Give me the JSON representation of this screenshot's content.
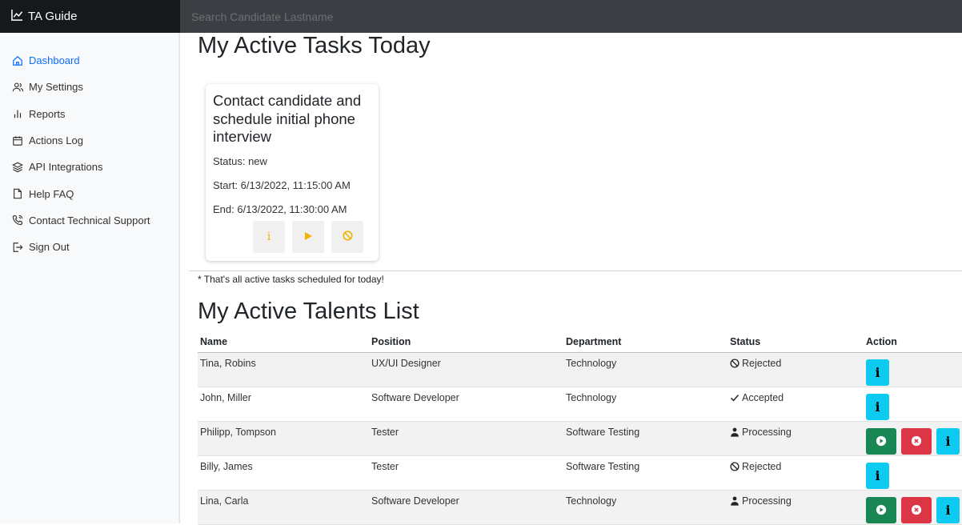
{
  "brand": {
    "name": "TA Guide",
    "icon": "line-chart-icon"
  },
  "search": {
    "placeholder": "Search Candidate Lastname"
  },
  "sidebar": {
    "items": [
      {
        "label": "Dashboard",
        "icon": "home-icon",
        "active": true
      },
      {
        "label": "My Settings",
        "icon": "users-icon"
      },
      {
        "label": "Reports",
        "icon": "bar-chart-icon"
      },
      {
        "label": "Actions Log",
        "icon": "calendar-icon"
      },
      {
        "label": "API Integrations",
        "icon": "layers-icon"
      },
      {
        "label": "Help FAQ",
        "icon": "file-icon"
      },
      {
        "label": "Contact Technical Support",
        "icon": "phone-icon"
      },
      {
        "label": "Sign Out",
        "icon": "sign-out-icon"
      }
    ]
  },
  "tasks": {
    "heading": "My Active Tasks Today",
    "card": {
      "title": "Contact candidate and schedule initial phone interview",
      "status": "Status: new",
      "start": "Start: 6/13/2022, 11:15:00 AM",
      "end": "End: 6/13/2022, 11:30:00 AM",
      "buttons": {
        "info": "i"
      }
    },
    "note": "* That's all active tasks scheduled for today!"
  },
  "talents": {
    "heading": "My Active Talents List",
    "columns": [
      "Name",
      "Position",
      "Department",
      "Status",
      "Action"
    ],
    "rows": [
      {
        "name": "Tina, Robins",
        "position": "UX/UI Designer",
        "department": "Technology",
        "status": "Rejected",
        "status_icon": "ban-icon",
        "actions": [
          "info"
        ]
      },
      {
        "name": "John, Miller",
        "position": "Software Developer",
        "department": "Technology",
        "status": "Accepted",
        "status_icon": "check-icon",
        "actions": [
          "info"
        ]
      },
      {
        "name": "Philipp, Tompson",
        "position": "Tester",
        "department": "Software Testing",
        "status": "Processing",
        "status_icon": "user-icon",
        "actions": [
          "start",
          "cancel",
          "info"
        ]
      },
      {
        "name": "Billy, James",
        "position": "Tester",
        "department": "Software Testing",
        "status": "Rejected",
        "status_icon": "ban-icon",
        "actions": [
          "info"
        ]
      },
      {
        "name": "Lina, Carla",
        "position": "Software Developer",
        "department": "Technology",
        "status": "Processing",
        "status_icon": "user-icon",
        "actions": [
          "start",
          "cancel",
          "info"
        ]
      }
    ],
    "info_label": "i"
  },
  "colors": {
    "accent": "#0d6efd",
    "info": "#0dcaf0",
    "success": "#198754",
    "danger": "#dc3545",
    "warning": "#f0b400"
  }
}
